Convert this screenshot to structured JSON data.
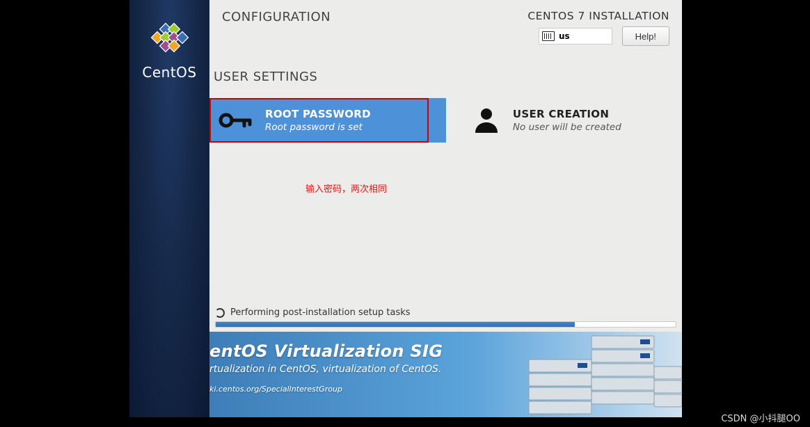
{
  "sidebar": {
    "product_name": "CentOS"
  },
  "header": {
    "title": "CONFIGURATION",
    "install_title": "CENTOS 7 INSTALLATION",
    "keyboard_layout": "us",
    "help_label": "Help!"
  },
  "section": {
    "title": "USER SETTINGS"
  },
  "settings": {
    "root_password": {
      "title": "ROOT PASSWORD",
      "subtitle": "Root password is set"
    },
    "user_creation": {
      "title": "USER CREATION",
      "subtitle": "No user will be created"
    }
  },
  "annotation": "输入密码，两次相同",
  "progress": {
    "status_text": "Performing post-installation setup tasks",
    "percent": 78
  },
  "banner": {
    "title": "entOS Virtualization SIG",
    "subtitle": "rtualization in CentOS, virtualization of CentOS.",
    "url": "ki.centos.org/SpecialInterestGroup"
  },
  "watermark": "CSDN @小抖腿OO"
}
